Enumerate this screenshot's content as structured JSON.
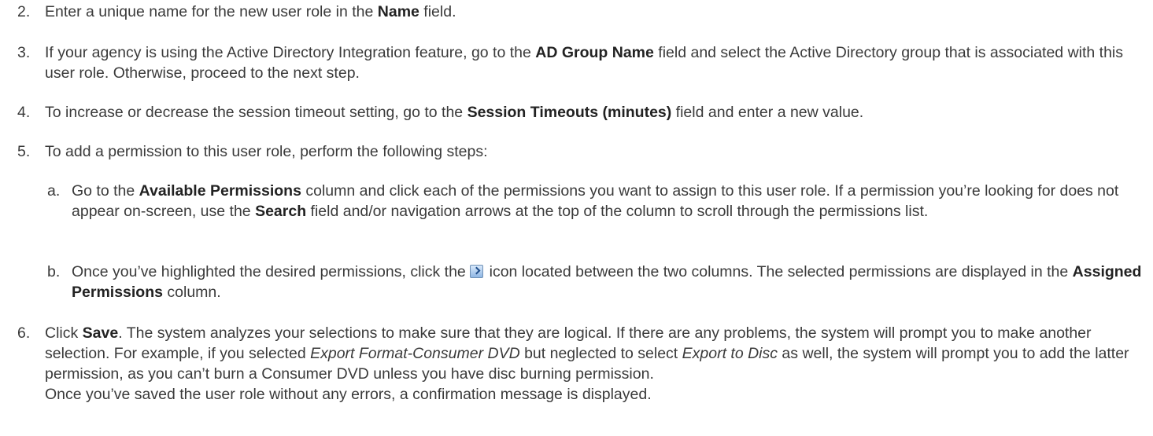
{
  "steps": [
    {
      "num": "2.",
      "parts": [
        "Enter a unique name for the new user role in the ",
        "Name",
        " field."
      ]
    },
    {
      "num": "3.",
      "parts": [
        "If your agency is using the Active Directory Integration feature, go to the ",
        "AD Group Name",
        " field and select the Active Directory group that is associated with this user role. Otherwise, proceed to the next step."
      ]
    },
    {
      "num": "4.",
      "parts": [
        "To increase or decrease the session timeout setting, go to the ",
        "Session Timeouts (minutes)",
        " field and enter a new value."
      ]
    },
    {
      "num": "5.",
      "parts": [
        "To add a permission to this user role, perform the following steps:"
      ],
      "substeps": [
        {
          "letter": "a.",
          "parts": [
            "Go to the ",
            "Available Permissions",
            " column and click each of the permissions you want to assign to this user role. If a permission you’re looking for does not appear on-screen, use the ",
            "Search",
            " field and/or navigation arrows at the top of the column to scroll through the permissions list."
          ]
        },
        {
          "letter": "b.",
          "parts": [
            "Once you’ve highlighted the desired permissions, click the ",
            " icon located between the two columns. The selected permissions are displayed in the ",
            "Assigned Permissions",
            " column."
          ]
        }
      ]
    },
    {
      "num": "6.",
      "parts": [
        "Click ",
        "Save",
        ". The system analyzes your selections to make sure that they are logical. If there are any problems, the system will prompt you to make another selection. For example, if you selected ",
        "Export Format-Consumer DVD",
        " but neglected to select ",
        "Export to Disc",
        " as well, the system will prompt you to add the latter permission, as you can’t burn a Consumer DVD unless you have disc burning permission."
      ],
      "after": "Once you’ve saved the user role without any errors, a confirmation message is displayed."
    }
  ],
  "icons": {
    "move_right": "move-right-arrow-icon"
  }
}
